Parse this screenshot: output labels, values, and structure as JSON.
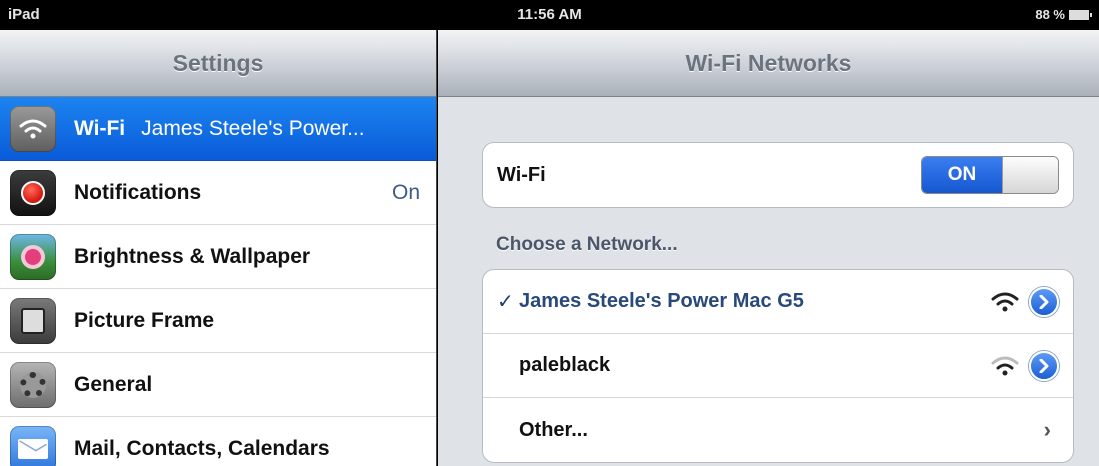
{
  "status_bar": {
    "carrier": "iPad",
    "time": "11:56 AM",
    "battery": "88 %"
  },
  "left_pane": {
    "title": "Settings",
    "items": [
      {
        "label": "Wi-Fi",
        "detail": "James Steele's Power...",
        "icon": "wifi-icon",
        "selected": true
      },
      {
        "label": "Notifications",
        "value": "On",
        "icon": "notifications-icon"
      },
      {
        "label": "Brightness & Wallpaper",
        "icon": "brightness-icon"
      },
      {
        "label": "Picture Frame",
        "icon": "picture-frame-icon"
      },
      {
        "label": "General",
        "icon": "gear-icon"
      },
      {
        "label": "Mail, Contacts, Calendars",
        "icon": "mail-icon"
      }
    ]
  },
  "right_pane": {
    "title": "Wi-Fi Networks",
    "wifi_toggle": {
      "label": "Wi-Fi",
      "state": "ON"
    },
    "choose_header": "Choose a Network...",
    "networks": [
      {
        "name": "James Steele's Power Mac G5",
        "connected": true,
        "check": "✓"
      },
      {
        "name": "paleblack",
        "connected": false
      },
      {
        "name": "Other...",
        "chevron": "›"
      }
    ]
  },
  "colors": {
    "selection": "#0a5bd8",
    "toggle_on": "#1557d0",
    "detail_button": "#1c5fd4"
  }
}
